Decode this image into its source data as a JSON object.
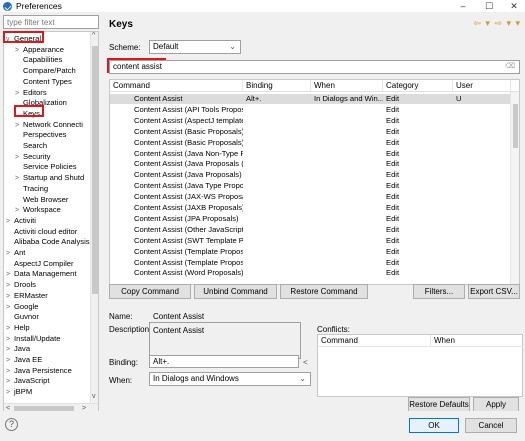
{
  "window": {
    "title": "Preferences",
    "min_glyph": "–",
    "max_glyph": "☐",
    "close_glyph": "✕"
  },
  "filter": {
    "placeholder": "type filter text"
  },
  "tree": [
    {
      "label": "General",
      "toggle": "v",
      "indent": 0
    },
    {
      "label": "Appearance",
      "toggle": ">",
      "indent": 1
    },
    {
      "label": "Capabilities",
      "toggle": "",
      "indent": 1
    },
    {
      "label": "Compare/Patch",
      "toggle": "",
      "indent": 1
    },
    {
      "label": "Content Types",
      "toggle": "",
      "indent": 1
    },
    {
      "label": "Editors",
      "toggle": ">",
      "indent": 1
    },
    {
      "label": "Globalization",
      "toggle": "",
      "indent": 1
    },
    {
      "label": "Keys",
      "toggle": "",
      "indent": 1
    },
    {
      "label": "Network Connecti",
      "toggle": ">",
      "indent": 1
    },
    {
      "label": "Perspectives",
      "toggle": "",
      "indent": 1
    },
    {
      "label": "Search",
      "toggle": "",
      "indent": 1
    },
    {
      "label": "Security",
      "toggle": ">",
      "indent": 1
    },
    {
      "label": "Service Policies",
      "toggle": "",
      "indent": 1
    },
    {
      "label": "Startup and Shutd",
      "toggle": ">",
      "indent": 1
    },
    {
      "label": "Tracing",
      "toggle": "",
      "indent": 1
    },
    {
      "label": "Web Browser",
      "toggle": "",
      "indent": 1
    },
    {
      "label": "Workspace",
      "toggle": ">",
      "indent": 1
    },
    {
      "label": "Activiti",
      "toggle": ">",
      "indent": 0
    },
    {
      "label": "Activiti cloud editor",
      "toggle": "",
      "indent": 0
    },
    {
      "label": "Alibaba Code Analysis",
      "toggle": "",
      "indent": 0
    },
    {
      "label": "Ant",
      "toggle": ">",
      "indent": 0
    },
    {
      "label": "AspectJ Compiler",
      "toggle": "",
      "indent": 0
    },
    {
      "label": "Data Management",
      "toggle": ">",
      "indent": 0
    },
    {
      "label": "Drools",
      "toggle": ">",
      "indent": 0
    },
    {
      "label": "ERMaster",
      "toggle": ">",
      "indent": 0
    },
    {
      "label": "Google",
      "toggle": ">",
      "indent": 0
    },
    {
      "label": "Guvnor",
      "toggle": "",
      "indent": 0
    },
    {
      "label": "Help",
      "toggle": ">",
      "indent": 0
    },
    {
      "label": "Install/Update",
      "toggle": ">",
      "indent": 0
    },
    {
      "label": "Java",
      "toggle": ">",
      "indent": 0
    },
    {
      "label": "Java EE",
      "toggle": ">",
      "indent": 0
    },
    {
      "label": "Java Persistence",
      "toggle": ">",
      "indent": 0
    },
    {
      "label": "JavaScript",
      "toggle": ">",
      "indent": 0
    },
    {
      "label": "jBPM",
      "toggle": ">",
      "indent": 0
    }
  ],
  "page": {
    "title": "Keys",
    "nav_glyph": "⇦ ▾ ⇨ ▾ ▾"
  },
  "scheme": {
    "label": "Scheme:",
    "value": "Default"
  },
  "search": {
    "value": "content assist"
  },
  "table": {
    "columns": [
      "Command",
      "Binding",
      "When",
      "Category",
      "User"
    ],
    "rows": [
      [
        "Content Assist",
        "Alt+.",
        "In Dialogs and Win...",
        "Edit",
        "U"
      ],
      [
        "Content Assist (API Tools Proposa",
        "",
        "",
        "Edit",
        ""
      ],
      [
        "Content Assist (AspectJ templates)",
        "",
        "",
        "Edit",
        ""
      ],
      [
        "Content Assist (Basic Proposals)",
        "",
        "",
        "Edit",
        ""
      ],
      [
        "Content Assist (Basic Proposals)",
        "",
        "",
        "Edit",
        ""
      ],
      [
        "Content Assist (Java Non-Type Pro",
        "",
        "",
        "Edit",
        ""
      ],
      [
        "Content Assist (Java Proposals (Ta",
        "",
        "",
        "Edit",
        ""
      ],
      [
        "Content Assist (Java Proposals)",
        "",
        "",
        "Edit",
        ""
      ],
      [
        "Content Assist (Java Type Proposa",
        "",
        "",
        "Edit",
        ""
      ],
      [
        "Content Assist (JAX-WS Proposals",
        "",
        "",
        "Edit",
        ""
      ],
      [
        "Content Assist (JAXB Proposals)",
        "",
        "",
        "Edit",
        ""
      ],
      [
        "Content Assist (JPA Proposals)",
        "",
        "",
        "Edit",
        ""
      ],
      [
        "Content Assist (Other JavaScript P",
        "",
        "",
        "Edit",
        ""
      ],
      [
        "Content Assist (SWT Template Pro",
        "",
        "",
        "Edit",
        ""
      ],
      [
        "Content Assist (Template Proposa",
        "",
        "",
        "Edit",
        ""
      ],
      [
        "Content Assist (Template Proposa",
        "",
        "",
        "Edit",
        ""
      ],
      [
        "Content Assist (Word Proposals)",
        "",
        "",
        "Edit",
        ""
      ]
    ]
  },
  "buttons": {
    "copy": "Copy Command",
    "unbind": "Unbind Command",
    "restore": "Restore Command",
    "filters": "Filters...",
    "export": "Export CSV...",
    "restore_defaults": "Restore Defaults",
    "apply": "Apply",
    "ok": "OK",
    "cancel": "Cancel"
  },
  "details": {
    "name_label": "Name:",
    "name_value": "Content Assist",
    "description_label": "Description:",
    "description_value": "Content Assist",
    "binding_label": "Binding:",
    "binding_value": "Alt+.",
    "binding_arrow": "<",
    "when_label": "When:",
    "when_value": "In Dialogs and Windows",
    "conflicts_label": "Conflicts:",
    "conflicts_columns": [
      "Command",
      "When"
    ]
  },
  "help_glyph": "?",
  "colors": {
    "highlight": "#e0161a",
    "selection": "#dcdcdc",
    "primary_border": "#0078d7"
  }
}
